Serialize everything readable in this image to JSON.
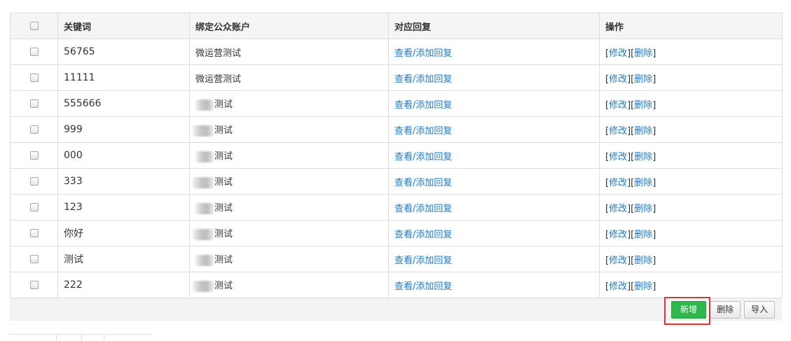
{
  "table": {
    "headers": {
      "keyword": "关键词",
      "account": "绑定公众账户",
      "reply": "对应回复",
      "ops": "操作"
    },
    "rows": [
      {
        "keyword": "56765",
        "account": "微运营测试",
        "account_blurred": false,
        "reply": "查看/添加回复",
        "edit": "修改",
        "del": "删除"
      },
      {
        "keyword": "11111",
        "account": "微运营测试",
        "account_blurred": false,
        "reply": "查看/添加回复",
        "edit": "修改",
        "del": "删除"
      },
      {
        "keyword": "555666",
        "account": "测试",
        "account_blurred": true,
        "reply": "查看/添加回复",
        "edit": "修改",
        "del": "删除"
      },
      {
        "keyword": "999",
        "account": "测试",
        "account_blurred": true,
        "reply": "查看/添加回复",
        "edit": "修改",
        "del": "删除"
      },
      {
        "keyword": "000",
        "account": "测试",
        "account_blurred": true,
        "reply": "查看/添加回复",
        "edit": "修改",
        "del": "删除"
      },
      {
        "keyword": "333",
        "account": "测试",
        "account_blurred": true,
        "reply": "查看/添加回复",
        "edit": "修改",
        "del": "删除"
      },
      {
        "keyword": "123",
        "account": "测试",
        "account_blurred": true,
        "reply": "查看/添加回复",
        "edit": "修改",
        "del": "删除"
      },
      {
        "keyword": "你好",
        "account": "测试",
        "account_blurred": true,
        "reply": "查看/添加回复",
        "edit": "修改",
        "del": "删除"
      },
      {
        "keyword": "测试",
        "account": "测试",
        "account_blurred": true,
        "reply": "查看/添加回复",
        "edit": "修改",
        "del": "删除"
      },
      {
        "keyword": "222",
        "account": "测试",
        "account_blurred": true,
        "reply": "查看/添加回复",
        "edit": "修改",
        "del": "删除"
      }
    ]
  },
  "actions": {
    "add_label": "新增",
    "delete_label": "删除",
    "import_label": "导入"
  },
  "colors": {
    "link": "#1a7bc9",
    "add_button": "#2fb84a",
    "highlight": "#e03131"
  }
}
